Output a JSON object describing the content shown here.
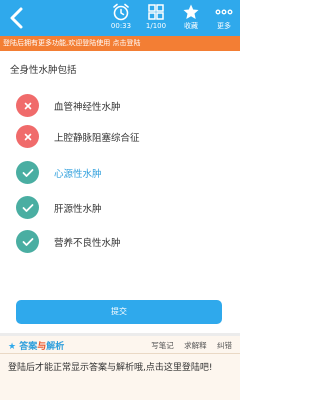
{
  "header": {
    "timer": "00:33",
    "progress": "1/100",
    "favorite_label": "收藏",
    "more_label": "更多",
    "bg_color": "#2fa9ec"
  },
  "banner": {
    "text": "登陆后拥有更多功能,欢迎登陆使用 点击登陆",
    "bg_color": "#f37e34"
  },
  "question": {
    "text": "全身性水肿包括"
  },
  "options": [
    {
      "label": "血管神经性水肿",
      "state": "wrong",
      "icon": "cross-icon"
    },
    {
      "label": "上腔静脉阻塞综合征",
      "state": "wrong",
      "icon": "cross-icon"
    },
    {
      "label": "心源性水肿",
      "state": "correct",
      "icon": "check-icon"
    },
    {
      "label": "肝源性水肿",
      "state": "correct",
      "icon": "check-icon"
    },
    {
      "label": "营养不良性水肿",
      "state": "correct",
      "icon": "check-icon"
    }
  ],
  "submit_label": "提交",
  "answer": {
    "title_star": "★",
    "title_part1": "答案",
    "title_part2": "与",
    "title_part3": "解析",
    "links": [
      "写笔记",
      "求解释",
      "纠错"
    ],
    "body": "登陆后才能正常显示答案与解析哦,点击这里登陆吧!"
  },
  "colors": {
    "wrong": "#f06b6b",
    "correct": "#4aaea2",
    "accent": "#2fa9ec"
  }
}
